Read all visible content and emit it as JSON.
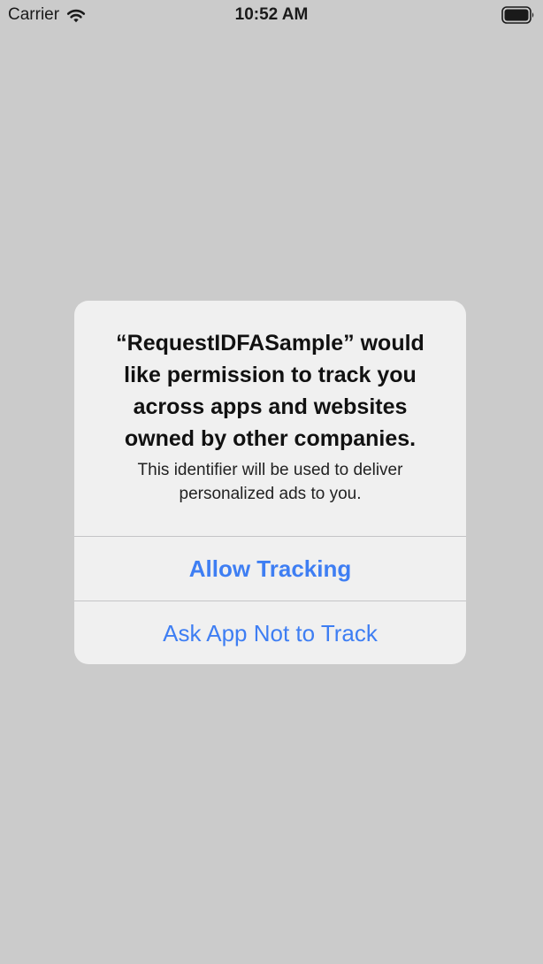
{
  "status_bar": {
    "carrier": "Carrier",
    "time": "10:52 AM",
    "wifi_icon": "wifi-icon",
    "battery_icon": "battery-full-icon"
  },
  "alert": {
    "title": "“RequestIDFASample” would like permission to track you across apps and websites owned by other companies.",
    "message": "This identifier will be used to deliver personalized ads to you.",
    "allow_label": "Allow Tracking",
    "deny_label": "Ask App Not to Track"
  },
  "colors": {
    "background": "#cbcbcb",
    "alert_background": "#f0f0f0",
    "button_text": "#3e7ef3",
    "divider": "#c4c4c6"
  }
}
